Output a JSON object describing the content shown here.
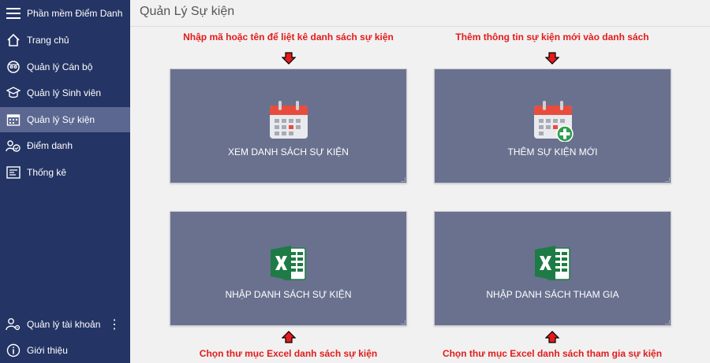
{
  "app": {
    "title": "Phần mềm Điểm Danh",
    "page_title": "Quản Lý Sự kiện"
  },
  "sidebar": {
    "items": [
      {
        "label": "Trang chủ",
        "icon": "home-icon"
      },
      {
        "label": "Quản lý Cán bộ",
        "icon": "staff-icon"
      },
      {
        "label": "Quản lý Sinh viên",
        "icon": "graduation-cap-icon"
      },
      {
        "label": "Quản lý Sự kiện",
        "icon": "calendar-icon",
        "active": true
      },
      {
        "label": "Điểm danh",
        "icon": "attendance-icon"
      },
      {
        "label": "Thống kê",
        "icon": "statistics-icon"
      }
    ],
    "bottom": [
      {
        "label": "Quản lý tài khoản",
        "icon": "account-settings-icon"
      },
      {
        "label": "Giới thiệu",
        "icon": "info-icon"
      }
    ],
    "more_glyph": "⋮"
  },
  "hints": {
    "view": "Nhập mã hoặc tên để liệt kê danh sách sự kiện",
    "add": "Thêm thông tin sự kiện mới vào danh sách",
    "import_events": "Chọn thư mục Excel danh sách sự kiện",
    "import_participants": "Chọn thư mục Excel danh sách tham gia sự kiện"
  },
  "tiles": {
    "view": {
      "label": "XEM DANH SÁCH SỰ KIỆN",
      "icon": "calendar-icon"
    },
    "add": {
      "label": "THÊM SỰ KIỆN MỚI",
      "icon": "calendar-add-icon"
    },
    "import_events": {
      "label": "NHẬP DANH SÁCH SỰ KIỆN",
      "icon": "excel-icon"
    },
    "import_participants": {
      "label": "NHẬP DANH SÁCH THAM GIA",
      "icon": "excel-icon"
    }
  },
  "colors": {
    "sidebar_bg": "#243464",
    "sidebar_active": "#5b6790",
    "tile_bg": "#69718e",
    "hint_red": "#e41b1b",
    "excel_green": "#1e7b45"
  }
}
